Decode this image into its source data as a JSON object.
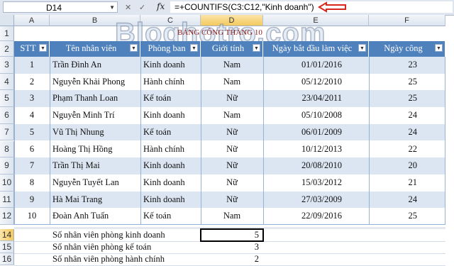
{
  "formula_bar": {
    "name_box": "D14",
    "fx_label": "fx",
    "formula": "=+COUNTIFS(C3:C12,\"Kinh doanh\")"
  },
  "watermark": "Bloghotro.com",
  "sheet_title": "BẢNG CÔNG THÁNG 10",
  "columns": [
    "A",
    "B",
    "C",
    "D",
    "E",
    "F"
  ],
  "rows": [
    "1",
    "2",
    "3",
    "4",
    "5",
    "6",
    "7",
    "8",
    "9",
    "10",
    "11",
    "12",
    "14",
    "15",
    "16"
  ],
  "table": {
    "headers": [
      "STT",
      "Tên nhân viên",
      "Phòng ban",
      "Giới tính",
      "Ngày bắt đầu làm việc",
      "Ngày công"
    ],
    "data": [
      [
        "1",
        "Trần Đình An",
        "Kinh doanh",
        "Nam",
        "01/01/2016",
        "23"
      ],
      [
        "2",
        "Nguyễn Khải Phong",
        "Hành chính",
        "Nam",
        "05/12/2010",
        "25"
      ],
      [
        "3",
        "Phạm Thanh Loan",
        "Kế toán",
        "Nữ",
        "23/04/2011",
        "25"
      ],
      [
        "4",
        "Nguyễn Minh Trí",
        "Kinh doanh",
        "Nam",
        "05/10/2008",
        "24"
      ],
      [
        "5",
        "Vũ Thị Nhung",
        "Kế toán",
        "Nữ",
        "06/01/2009",
        "24"
      ],
      [
        "6",
        "Hoàng Thị Hồng",
        "Hành chính",
        "Nữ",
        "10/12/2013",
        "22"
      ],
      [
        "7",
        "Trần Thị Mai",
        "Kinh doanh",
        "Nữ",
        "20/08/2010",
        "20"
      ],
      [
        "8",
        "Nguyễn Tuyết Lan",
        "Kinh doanh",
        "Nữ",
        "15/03/2012",
        "21"
      ],
      [
        "9",
        "Hà Mai Trang",
        "Kinh doanh",
        "Nữ",
        "27/03/2009",
        "24"
      ],
      [
        "10",
        "Đoàn Anh Tuấn",
        "Kế toán",
        "Nam",
        "22/09/2016",
        "25"
      ]
    ]
  },
  "summary": [
    {
      "label": "Số nhân viên phòng kinh doanh",
      "value": "5"
    },
    {
      "label": "Số nhân viên phòng kế toán",
      "value": "3"
    },
    {
      "label": "Số nhân viên phòng hành chính",
      "value": "2"
    }
  ],
  "colors": {
    "table_header": "#4f81bd",
    "band": "#dce6f2",
    "arrow": "#d9261c"
  }
}
